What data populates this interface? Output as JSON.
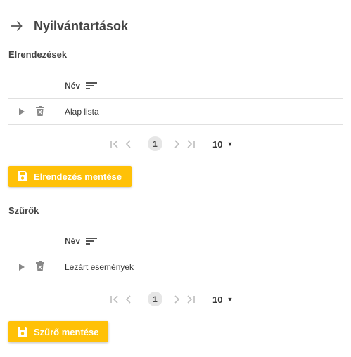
{
  "header": {
    "title": "Nyilvántartások",
    "back_icon": "arrow-right-icon"
  },
  "layouts": {
    "section_title": "Elrendezések",
    "column_name": "Név",
    "rows": [
      {
        "name": "Alap lista"
      }
    ],
    "pager": {
      "current_page": "1",
      "page_size": "10"
    },
    "save_label": "Elrendezés mentése"
  },
  "filters": {
    "section_title": "Szűrők",
    "column_name": "Név",
    "rows": [
      {
        "name": "Lezárt események"
      }
    ],
    "pager": {
      "current_page": "1",
      "page_size": "10"
    },
    "save_label": "Szűrő mentése"
  },
  "colors": {
    "accent": "#ffc107",
    "pager_disabled": "#bdbdbd",
    "icon": "#888888"
  }
}
